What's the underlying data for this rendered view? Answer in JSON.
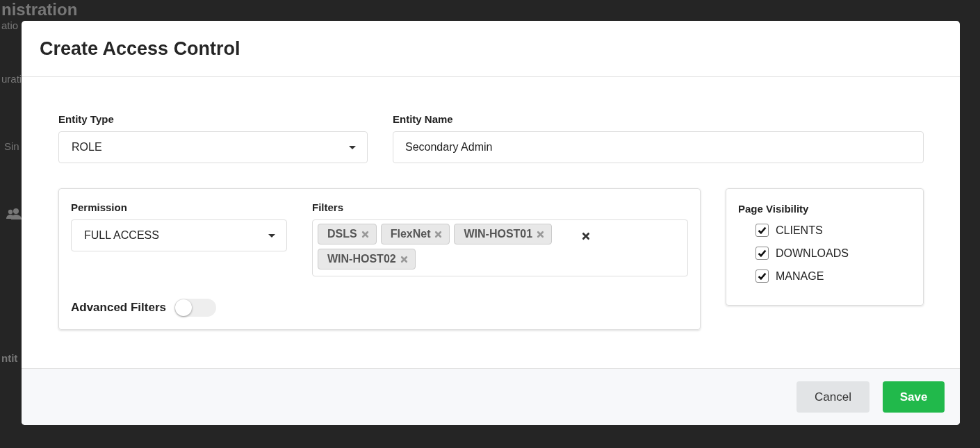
{
  "background": {
    "title": "nistration",
    "subtitle": "atio",
    "section": "urati",
    "row_text": "Sin",
    "footer_label": "ntit"
  },
  "dialog": {
    "title": "Create Access Control",
    "entity_type": {
      "label": "Entity Type",
      "value": "ROLE"
    },
    "entity_name": {
      "label": "Entity Name",
      "value": "Secondary Admin"
    },
    "permission": {
      "label": "Permission",
      "value": "FULL ACCESS"
    },
    "filters": {
      "label": "Filters",
      "tags": [
        {
          "text": "DSLS"
        },
        {
          "text": "FlexNet"
        },
        {
          "text": "WIN-HOST01"
        },
        {
          "text": "WIN-HOST02"
        }
      ]
    },
    "advanced_filters": {
      "label": "Advanced Filters",
      "on": false
    },
    "page_visibility": {
      "label": "Page Visibility",
      "items": [
        {
          "label": "CLIENTS",
          "checked": true
        },
        {
          "label": "DOWNLOADS",
          "checked": true
        },
        {
          "label": "MANAGE",
          "checked": true
        }
      ]
    },
    "buttons": [
      {
        "label": "Cancel",
        "kind": "secondary"
      },
      {
        "label": "Save",
        "kind": "primary"
      }
    ]
  }
}
